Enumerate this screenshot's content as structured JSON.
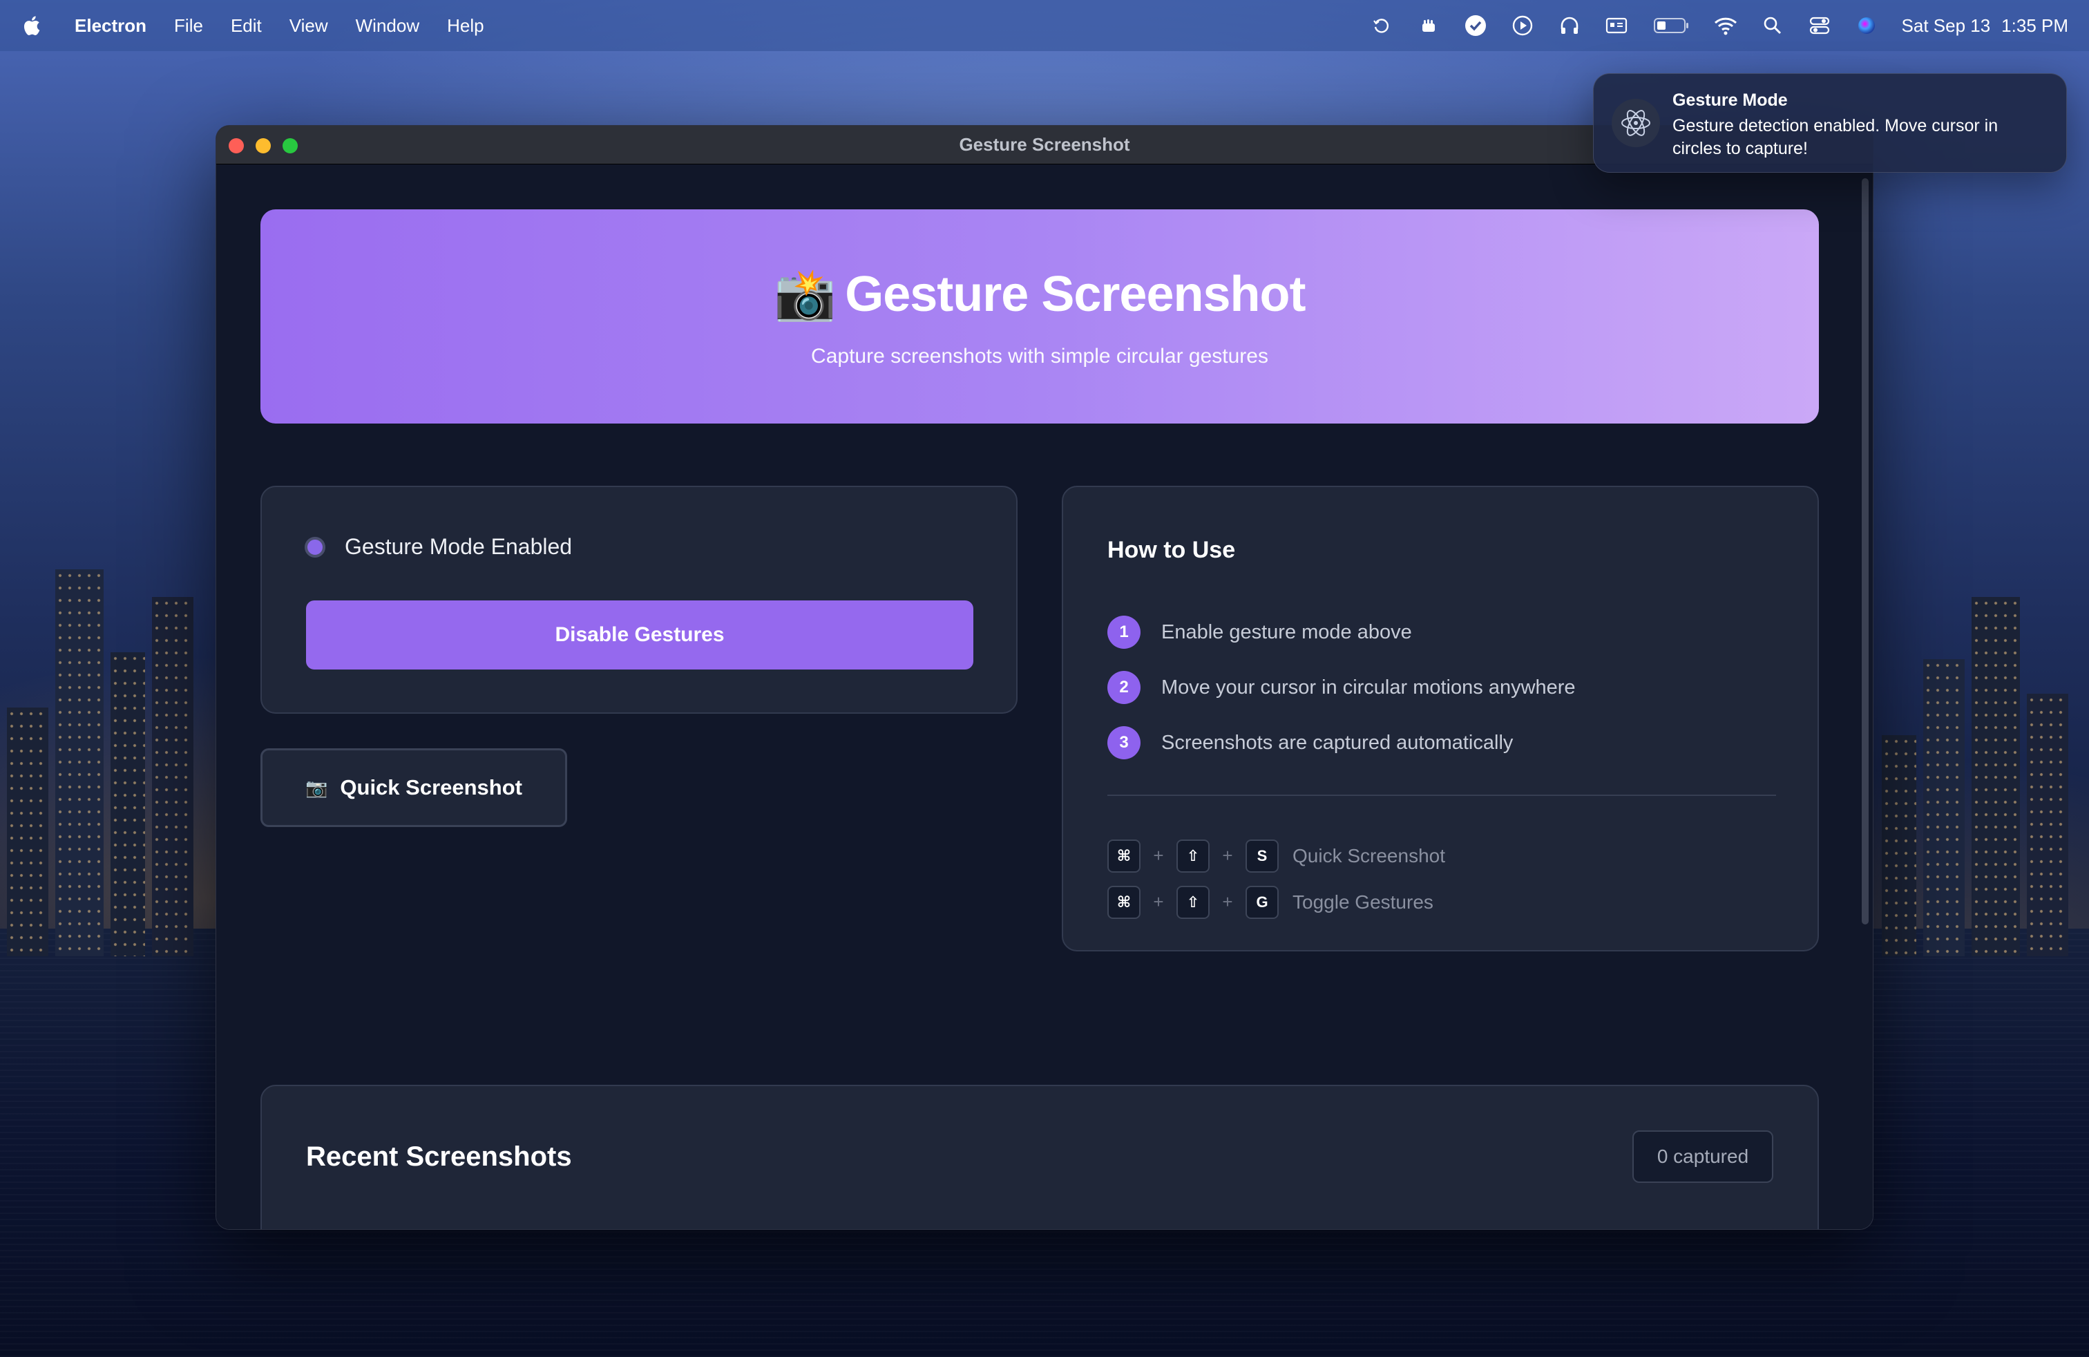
{
  "menubar": {
    "app": "Electron",
    "items": [
      "File",
      "Edit",
      "View",
      "Window",
      "Help"
    ],
    "date": "Sat Sep 13",
    "time": "1:35 PM"
  },
  "notification": {
    "title": "Gesture Mode",
    "body": "Gesture detection enabled. Move cursor in circles to capture!"
  },
  "window": {
    "title": "Gesture Screenshot"
  },
  "hero": {
    "emoji": "📸",
    "title": "Gesture Screenshot",
    "subtitle": "Capture screenshots with simple circular gestures"
  },
  "status": {
    "label": "Gesture Mode Enabled",
    "button": "Disable Gestures",
    "accent": "#9569ee"
  },
  "quick": {
    "emoji": "📷",
    "label": "Quick Screenshot"
  },
  "howto": {
    "title": "How to Use",
    "steps": [
      {
        "num": "1",
        "text": "Enable gesture mode above"
      },
      {
        "num": "2",
        "text": "Move your cursor in circular motions anywhere"
      },
      {
        "num": "3",
        "text": "Screenshots are captured automatically"
      }
    ],
    "shortcuts": [
      {
        "k1": "⌘",
        "plus1": "+",
        "k2": "⇧",
        "plus2": "+",
        "k3": "S",
        "label": "Quick Screenshot"
      },
      {
        "k1": "⌘",
        "plus1": "+",
        "k2": "⇧",
        "plus2": "+",
        "k3": "G",
        "label": "Toggle Gestures"
      }
    ]
  },
  "recent": {
    "title": "Recent Screenshots",
    "count": "0 captured"
  }
}
